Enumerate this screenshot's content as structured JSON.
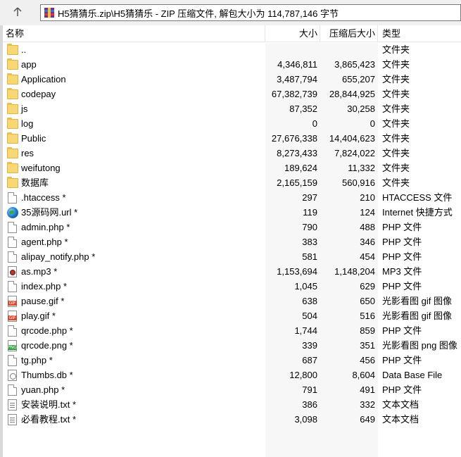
{
  "address": {
    "path_text": "H5猜猜乐.zip\\H5猜猜乐 - ZIP 压缩文件, 解包大小为 114,787,146 字节"
  },
  "columns": {
    "name": "名称",
    "size": "大小",
    "packed": "压缩后大小",
    "type": "类型"
  },
  "rows": [
    {
      "name": "..",
      "size": "",
      "packed": "",
      "type": "文件夹",
      "icon": "folder-icon",
      "kind": "folder"
    },
    {
      "name": "app",
      "size": "4,346,811",
      "packed": "3,865,423",
      "type": "文件夹",
      "icon": "folder-icon",
      "kind": "folder"
    },
    {
      "name": "Application",
      "size": "3,487,794",
      "packed": "655,207",
      "type": "文件夹",
      "icon": "folder-icon",
      "kind": "folder"
    },
    {
      "name": "codepay",
      "size": "67,382,739",
      "packed": "28,844,925",
      "type": "文件夹",
      "icon": "folder-icon",
      "kind": "folder"
    },
    {
      "name": "js",
      "size": "87,352",
      "packed": "30,258",
      "type": "文件夹",
      "icon": "folder-icon",
      "kind": "folder"
    },
    {
      "name": "log",
      "size": "0",
      "packed": "0",
      "type": "文件夹",
      "icon": "folder-icon",
      "kind": "folder"
    },
    {
      "name": "Public",
      "size": "27,676,338",
      "packed": "14,404,623",
      "type": "文件夹",
      "icon": "folder-icon",
      "kind": "folder"
    },
    {
      "name": "res",
      "size": "8,273,433",
      "packed": "7,824,022",
      "type": "文件夹",
      "icon": "folder-icon",
      "kind": "folder"
    },
    {
      "name": "weifutong",
      "size": "189,624",
      "packed": "11,332",
      "type": "文件夹",
      "icon": "folder-icon",
      "kind": "folder"
    },
    {
      "name": "数据库",
      "size": "2,165,159",
      "packed": "560,916",
      "type": "文件夹",
      "icon": "folder-icon",
      "kind": "folder"
    },
    {
      "name": ".htaccess *",
      "size": "297",
      "packed": "210",
      "type": "HTACCESS 文件",
      "icon": "file-icon",
      "kind": "file"
    },
    {
      "name": "35源码网.url *",
      "size": "119",
      "packed": "124",
      "type": "Internet 快捷方式",
      "icon": "globe-icon",
      "kind": "globe"
    },
    {
      "name": "admin.php *",
      "size": "790",
      "packed": "488",
      "type": "PHP 文件",
      "icon": "file-icon",
      "kind": "file"
    },
    {
      "name": "agent.php *",
      "size": "383",
      "packed": "346",
      "type": "PHP 文件",
      "icon": "file-icon",
      "kind": "file"
    },
    {
      "name": "alipay_notify.php *",
      "size": "581",
      "packed": "454",
      "type": "PHP 文件",
      "icon": "file-icon",
      "kind": "file"
    },
    {
      "name": "as.mp3 *",
      "size": "1,153,694",
      "packed": "1,148,204",
      "type": "MP3 文件",
      "icon": "audio-file-icon",
      "kind": "audio"
    },
    {
      "name": "index.php *",
      "size": "1,045",
      "packed": "629",
      "type": "PHP 文件",
      "icon": "file-icon",
      "kind": "file"
    },
    {
      "name": "pause.gif *",
      "size": "638",
      "packed": "650",
      "type": "光影看图 gif 图像",
      "icon": "gif-image-icon",
      "kind": "gif"
    },
    {
      "name": "play.gif *",
      "size": "504",
      "packed": "516",
      "type": "光影看图 gif 图像",
      "icon": "gif-image-icon",
      "kind": "gif"
    },
    {
      "name": "qrcode.php *",
      "size": "1,744",
      "packed": "859",
      "type": "PHP 文件",
      "icon": "file-icon",
      "kind": "file"
    },
    {
      "name": "qrcode.png *",
      "size": "339",
      "packed": "351",
      "type": "光影看图 png 图像",
      "icon": "png-image-icon",
      "kind": "png"
    },
    {
      "name": "tg.php *",
      "size": "687",
      "packed": "456",
      "type": "PHP 文件",
      "icon": "file-icon",
      "kind": "file"
    },
    {
      "name": "Thumbs.db *",
      "size": "12,800",
      "packed": "8,604",
      "type": "Data Base File",
      "icon": "database-file-icon",
      "kind": "db"
    },
    {
      "name": "yuan.php *",
      "size": "791",
      "packed": "491",
      "type": "PHP 文件",
      "icon": "file-icon",
      "kind": "file"
    },
    {
      "name": "安装说明.txt *",
      "size": "386",
      "packed": "332",
      "type": "文本文档",
      "icon": "text-file-icon",
      "kind": "txt"
    },
    {
      "name": "必看教程.txt *",
      "size": "3,098",
      "packed": "649",
      "type": "文本文档",
      "icon": "text-file-icon",
      "kind": "txt"
    }
  ]
}
